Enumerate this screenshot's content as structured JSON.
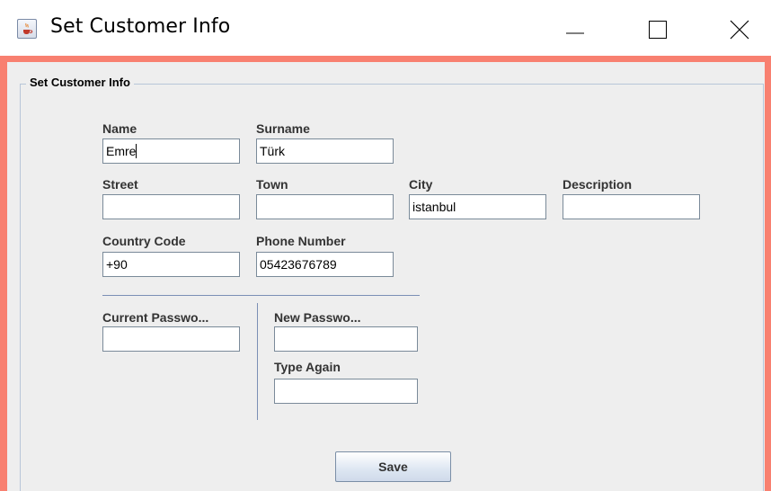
{
  "window": {
    "title": "Set Customer Info",
    "icon": "java-cup-icon",
    "controls": [
      "minimize-icon",
      "maximize-icon",
      "close-icon"
    ]
  },
  "panel": {
    "title": "Set Customer Info"
  },
  "fields": {
    "name": {
      "label": "Name",
      "value": "Emre"
    },
    "surname": {
      "label": "Surname",
      "value": "Türk"
    },
    "street": {
      "label": "Street",
      "value": ""
    },
    "town": {
      "label": "Town",
      "value": ""
    },
    "city": {
      "label": "City",
      "value": "istanbul"
    },
    "description": {
      "label": "Description",
      "value": ""
    },
    "country_code": {
      "label": "Country Code",
      "value": "+90"
    },
    "phone_number": {
      "label": "Phone Number",
      "value": "05423676789"
    }
  },
  "password": {
    "current": {
      "label": "Current Passwo...",
      "value": ""
    },
    "new": {
      "label": "New Passwo...",
      "value": ""
    },
    "again": {
      "label": "Type Again",
      "value": ""
    }
  },
  "actions": {
    "save_label": "Save"
  },
  "colors": {
    "frame": "#f88070",
    "content_bg": "#eeeeee",
    "separator": "#7b8fb5"
  }
}
